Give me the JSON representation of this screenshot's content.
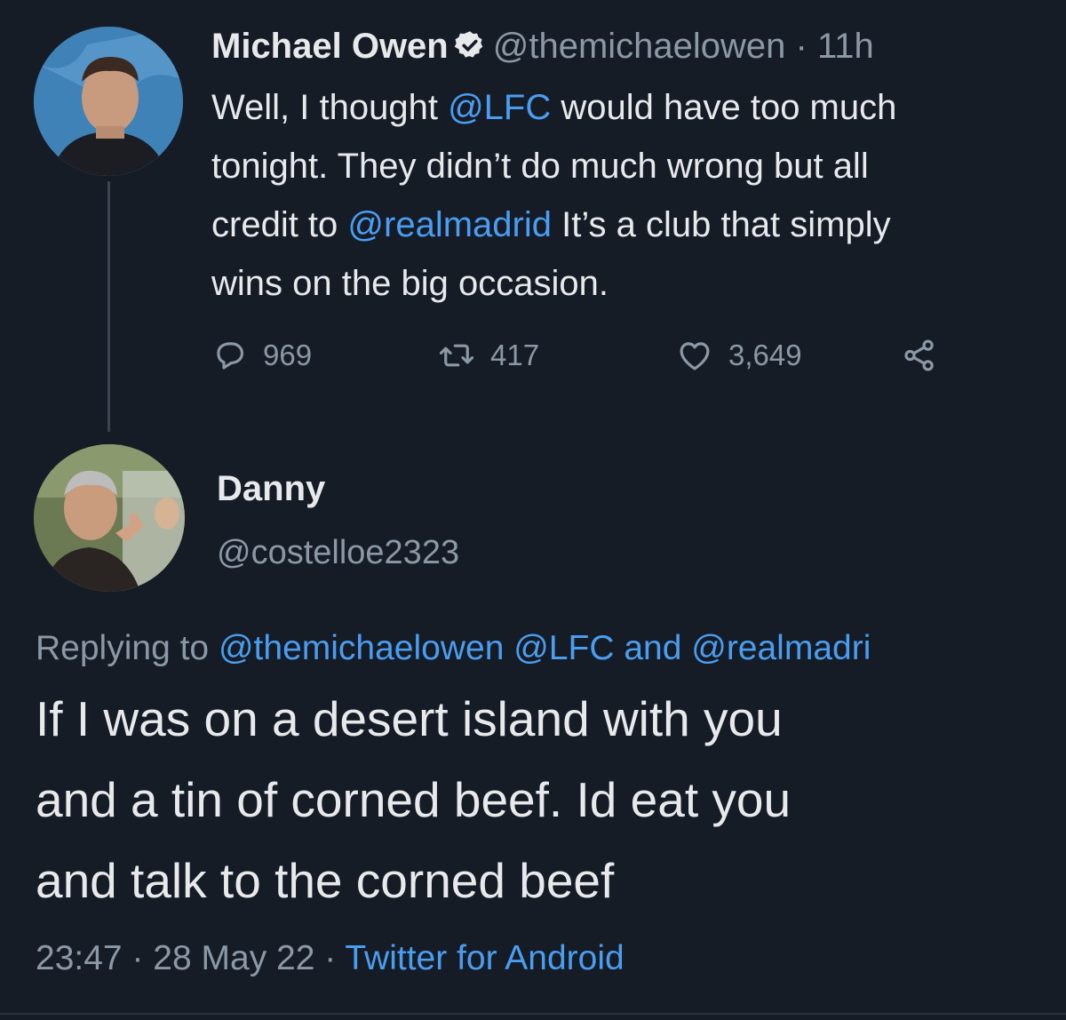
{
  "original_tweet": {
    "author_name": "Michael Owen",
    "handle": "@themichaelowen",
    "separator": "·",
    "time_ago": "11h",
    "text": {
      "part1": "Well, I thought ",
      "mention1": "@LFC",
      "part2": " would have too much",
      "line2": "tonight. They didn’t do much wrong but all",
      "line3_prefix": "credit to ",
      "mention2": "@realmadrid",
      "line3_suffix": " It’s a club that simply",
      "line4": "wins on the big occasion."
    },
    "stats": {
      "replies": "969",
      "retweets": "417",
      "likes": "3,649"
    },
    "icons": [
      "verified-badge-icon",
      "reply-icon",
      "retweet-icon",
      "like-icon",
      "share-icon"
    ]
  },
  "reply": {
    "author_name": "Danny",
    "handle": "@costelloe2323",
    "replying_to": {
      "prefix": "Replying to ",
      "mentions": "@themichaelowen @LFC and @realmadri"
    },
    "text": {
      "line1": "If I was on a desert island with you",
      "line2": "and a tin of corned beef. Id eat you",
      "line3": "and talk to the corned beef"
    },
    "meta": {
      "time": "23:47",
      "separator1": "·",
      "date": "28 May 22",
      "separator2": "·",
      "source": "Twitter for Android"
    }
  },
  "colors": {
    "background": "#161c26",
    "text": "#e7e9ea",
    "secondary": "#8b98a5",
    "link": "#4a9df0"
  }
}
